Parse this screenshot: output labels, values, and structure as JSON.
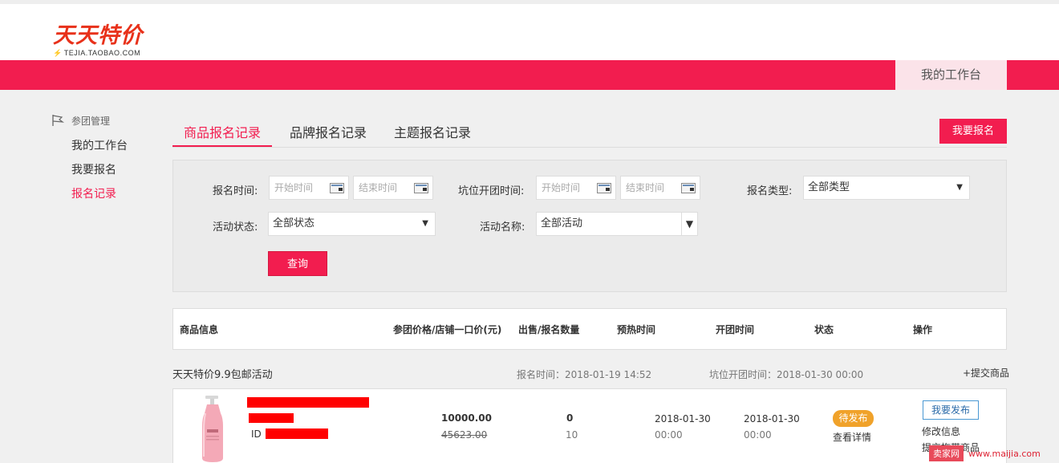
{
  "logo": {
    "main": "天天特价",
    "sub": "TEJIA.TAOBAO.COM"
  },
  "header": {
    "workbench_tab": "我的工作台"
  },
  "sidebar": {
    "section": "参团管理",
    "items": [
      {
        "label": "我的工作台"
      },
      {
        "label": "我要报名"
      },
      {
        "label": "报名记录"
      }
    ]
  },
  "tabs": [
    {
      "label": "商品报名记录"
    },
    {
      "label": "品牌报名记录"
    },
    {
      "label": "主题报名记录"
    }
  ],
  "apply_button": "我要报名",
  "filters": {
    "signup_time_label": "报名时间:",
    "start_placeholder": "开始时间",
    "end_placeholder": "结束时间",
    "slot_time_label": "坑位开团时间:",
    "slot_start_placeholder": "开始时间",
    "slot_end_placeholder": "结束时间",
    "signup_type_label": "报名类型:",
    "signup_type_value": "全部类型",
    "status_label": "活动状态:",
    "status_value": "全部状态",
    "activity_label": "活动名称:",
    "activity_value": "全部活动",
    "query_button": "查询"
  },
  "table": {
    "headers": [
      "商品信息",
      "参团价格/店铺一口价(元)",
      "出售/报名数量",
      "预热时间",
      "开团时间",
      "状态",
      "操作"
    ]
  },
  "group": {
    "title": "天天特价9.9包邮活动",
    "signup_time": "报名时间：2018-01-19 14:52",
    "slot_time": "坑位开团时间：2018-01-30 00:00",
    "submit_link": "+提交商品"
  },
  "row": {
    "id_label": "ID",
    "price": "10000.00",
    "original_price": "45623.00",
    "sold": "0",
    "quantity": "10",
    "preheat_date": "2018-01-30",
    "preheat_time": "00:00",
    "open_date": "2018-01-30",
    "open_time": "00:00",
    "status": "待发布",
    "details_link": "查看详情",
    "publish_button": "我要发布",
    "edit_link": "修改信息",
    "submit_bundle_link": "提交拖带商品"
  },
  "watermark": {
    "brand": "卖家网",
    "url": "www.maijia.com"
  },
  "colors": {
    "brand_red": "#f21d4f",
    "logo_red": "#e8311a",
    "status_orange": "#f0a22a",
    "link_blue": "#4a98d3"
  }
}
